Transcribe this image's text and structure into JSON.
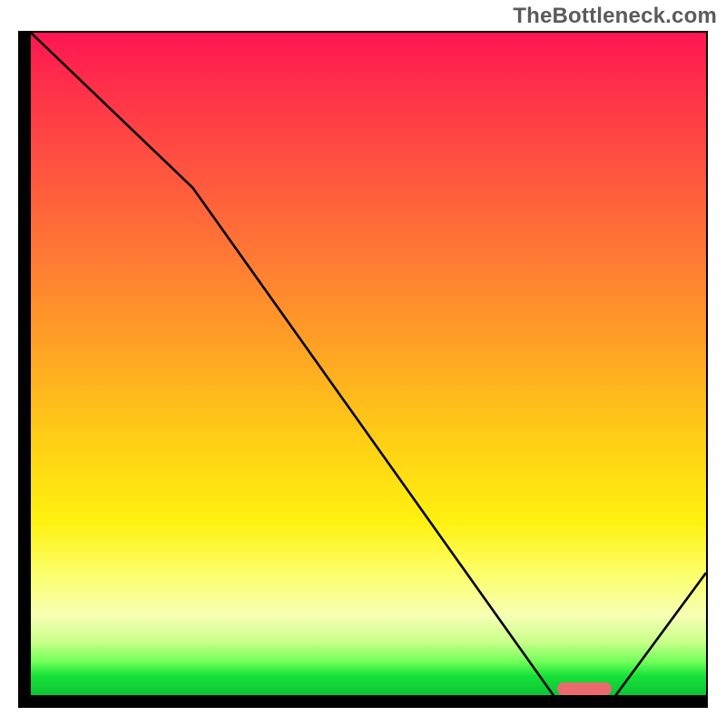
{
  "watermark": "TheBottleneck.com",
  "chart_data": {
    "type": "line",
    "title": "",
    "xlabel": "",
    "ylabel": "",
    "xlim": [
      0,
      100
    ],
    "ylim": [
      0,
      100
    ],
    "grid": false,
    "legend": false,
    "series": [
      {
        "name": "bottleneck-curve",
        "x": [
          0,
          24,
          78,
          86,
          100
        ],
        "values": [
          100,
          77,
          1,
          1,
          20
        ]
      }
    ],
    "marker": {
      "name": "optimal-range",
      "x_start": 78,
      "x_end": 86,
      "y": 1,
      "color": "#ea6a6e"
    },
    "gradient_background": {
      "top": "#ff1552",
      "mid": "#ffd015",
      "bottom": "#0cc433"
    }
  }
}
